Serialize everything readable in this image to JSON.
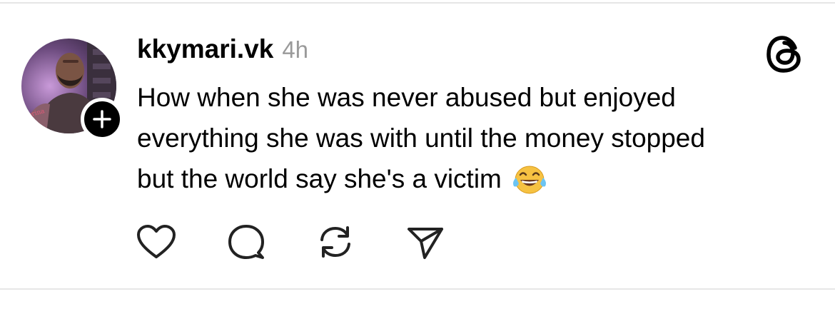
{
  "post": {
    "username": "kkymari.vk",
    "timestamp": "4h",
    "text_lines": [
      "How when she was never abused but enjoyed",
      "everything she was with until the money stopped",
      "but the world say she's a victim"
    ],
    "emoji": "😂"
  },
  "icons": {
    "follow": "plus-icon",
    "brand": "threads-logo-icon",
    "like": "heart-icon",
    "comment": "comment-bubble-icon",
    "repost": "repost-icon",
    "share": "send-icon"
  },
  "colors": {
    "text": "#000000",
    "timestamp": "#9a9a9a",
    "divider": "#e6e6e6",
    "icon": "#222222",
    "follow_button": "#000000"
  }
}
